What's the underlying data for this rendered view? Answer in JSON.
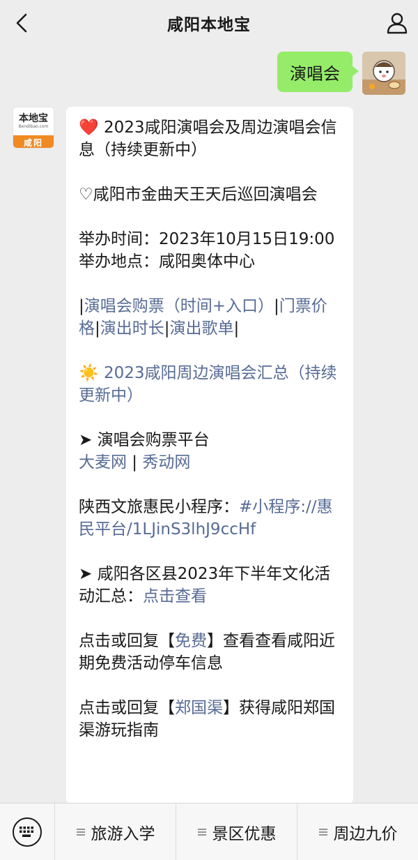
{
  "header": {
    "title": "咸阳本地宝",
    "back_icon": "chevron-left-icon",
    "profile_icon": "person-icon"
  },
  "user_message": {
    "text": "演唱会"
  },
  "bot": {
    "avatar": {
      "brand": "本地宝",
      "site": "Bendibao.com",
      "city": "咸阳"
    },
    "message": {
      "title_emoji": "❤️",
      "title": " 2023咸阳演唱会及周边演唱会信息（持续更新中）",
      "concert_line": "♡咸阳市金曲天王天后巡回演唱会",
      "time_line": "举办时间：2023年10月15日19:00",
      "place_line": "举办地点：咸阳奥体中心",
      "links_row": {
        "sep": "|",
        "ticket": "演唱会购票（时间+入口）",
        "price": "门票价格",
        "duration": "演出时长",
        "songs": "演出歌单"
      },
      "summary_emoji": "☀️",
      "summary": " 2023咸阳周边演唱会汇总（持续更新中）",
      "platform_title": "➤ 演唱会购票平台",
      "platform_damai": "大麦网",
      "platform_sep": " | ",
      "platform_xiudong": "秀动网",
      "miniapp_label": "陕西文旅惠民小程序：",
      "miniapp_link": "#小程序://惠民平台/1LJinS3lhJ9ccHf",
      "districts_label": "➤ 咸阳各区县2023年下半年文化活动汇总：",
      "districts_link": "点击查看",
      "free_pre": "点击或回复【",
      "free_link": "免费",
      "free_post": "】查看查看咸阳近期免费活动停车信息",
      "zgq_pre": "点击或回复【",
      "zgq_link": "郑国渠",
      "zgq_post": "】获得咸阳郑国渠游玩指南"
    }
  },
  "bottom_bar": {
    "keyboard_icon": "keyboard-icon",
    "menus": [
      {
        "label": "旅游入学"
      },
      {
        "label": "景区优惠"
      },
      {
        "label": "周边九价"
      }
    ]
  },
  "colors": {
    "background": "#ededed",
    "user_bubble": "#95ec69",
    "link": "#576b95",
    "brand_orange": "#f08a24"
  }
}
